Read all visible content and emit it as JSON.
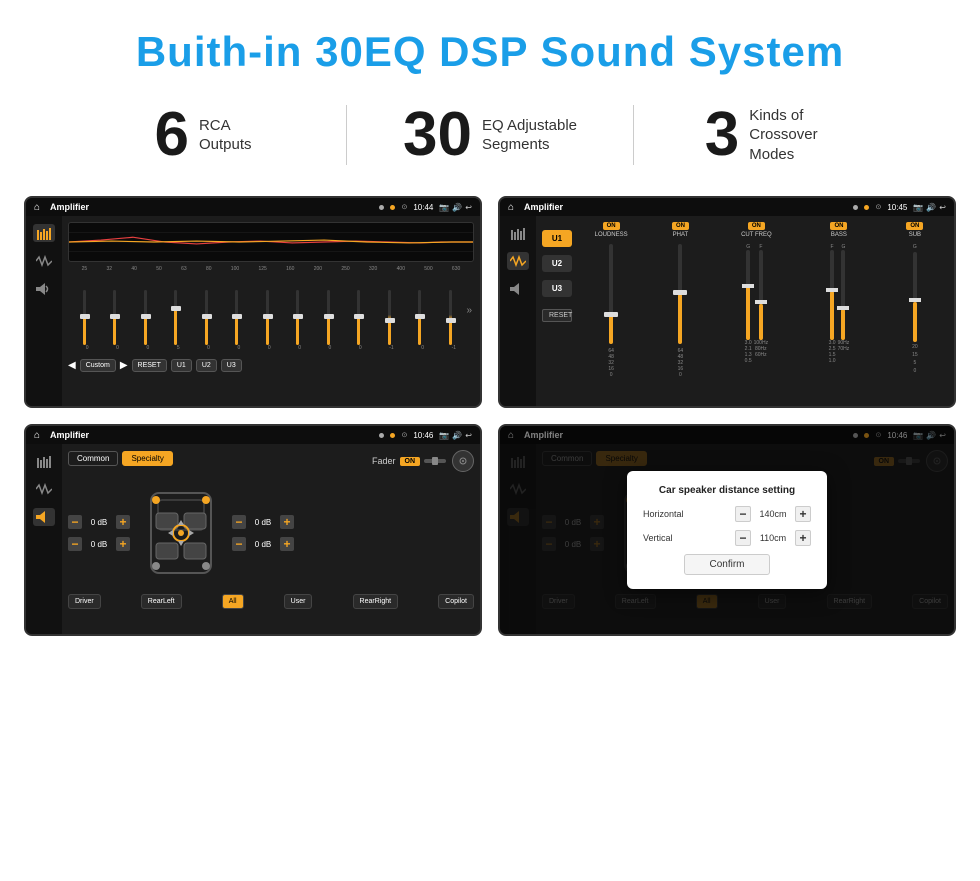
{
  "page": {
    "title": "Buith-in 30EQ DSP Sound System"
  },
  "stats": [
    {
      "number": "6",
      "text_line1": "RCA",
      "text_line2": "Outputs"
    },
    {
      "number": "30",
      "text_line1": "EQ Adjustable",
      "text_line2": "Segments"
    },
    {
      "number": "3",
      "text_line1": "Kinds of",
      "text_line2": "Crossover Modes"
    }
  ],
  "screenshots": {
    "eq": {
      "status_bar": {
        "time": "10:44",
        "title": "Amplifier"
      },
      "freq_labels": [
        "25",
        "32",
        "40",
        "50",
        "63",
        "80",
        "100",
        "125",
        "160",
        "200",
        "250",
        "320",
        "400",
        "500",
        "630"
      ],
      "slider_values": [
        "0",
        "0",
        "0",
        "5",
        "0",
        "0",
        "0",
        "0",
        "0",
        "0",
        "-1",
        "0",
        "-1"
      ],
      "buttons": [
        "Custom",
        "RESET",
        "U1",
        "U2",
        "U3"
      ]
    },
    "crossover": {
      "status_bar": {
        "time": "10:45",
        "title": "Amplifier"
      },
      "u_buttons": [
        "U1",
        "U2",
        "U3"
      ],
      "controls": [
        "LOUDNESS",
        "PHAT",
        "CUT FREQ",
        "BASS",
        "SUB"
      ],
      "reset_label": "RESET"
    },
    "fader": {
      "status_bar": {
        "time": "10:46",
        "title": "Amplifier"
      },
      "tabs": [
        "Common",
        "Specialty"
      ],
      "fader_label": "Fader",
      "on_text": "ON",
      "db_values": [
        "0 dB",
        "0 dB",
        "0 dB",
        "0 dB"
      ],
      "bottom_buttons": [
        "Driver",
        "RearLeft",
        "All",
        "User",
        "RearRight",
        "Copilot"
      ]
    },
    "distance": {
      "status_bar": {
        "time": "10:46",
        "title": "Amplifier"
      },
      "tabs": [
        "Common",
        "Specialty"
      ],
      "dialog": {
        "title": "Car speaker distance setting",
        "horizontal_label": "Horizontal",
        "horizontal_value": "140cm",
        "vertical_label": "Vertical",
        "vertical_value": "110cm",
        "confirm_label": "Confirm",
        "db_values": [
          "0 dB",
          "0 dB"
        ]
      }
    }
  }
}
